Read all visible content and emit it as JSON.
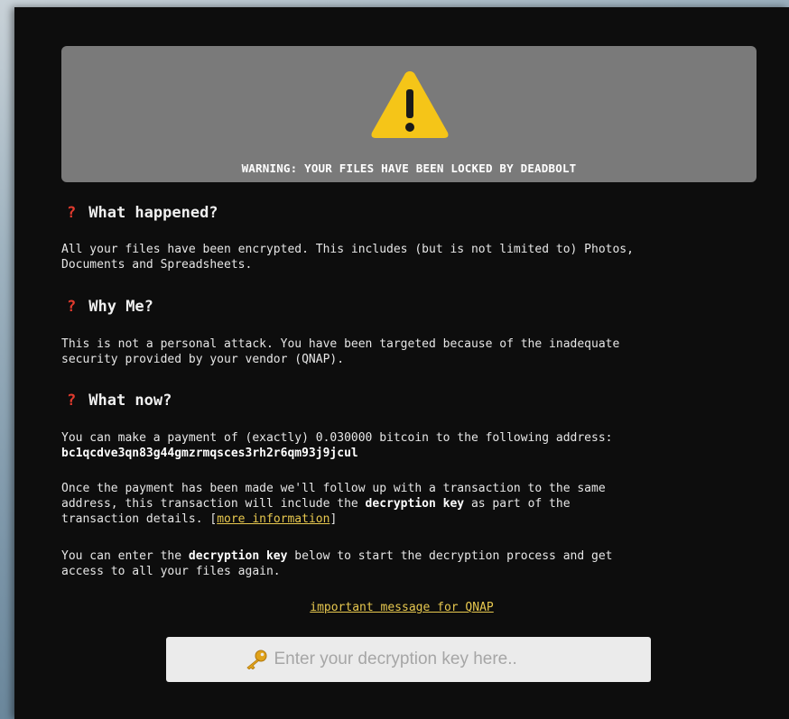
{
  "banner": {
    "icon": "warning-triangle-icon",
    "warning_text": "WARNING: YOUR FILES HAVE BEEN LOCKED BY DEADBOLT"
  },
  "sections": {
    "what_happened": {
      "icon": "question-mark-icon",
      "heading": "What happened?",
      "body": "All your files have been encrypted. This includes (but is not limited to) Photos,\nDocuments and Spreadsheets."
    },
    "why_me": {
      "icon": "question-mark-icon",
      "heading": "Why Me?",
      "body": "This is not a personal attack. You have been targeted because of the inadequate\nsecurity provided by your vendor (QNAP)."
    },
    "what_now": {
      "icon": "question-mark-icon",
      "heading": "What now?",
      "payment_line": "You can make a payment of (exactly) 0.030000 bitcoin to the following address:",
      "btc_address": "bc1qcdve3qn83g44gmzrmqsces3rh2r6qm93j9jcul",
      "followup_part1": "Once the payment has been made we'll follow up with a transaction to the same\naddress, this transaction will include the ",
      "followup_bold": "decryption key",
      "followup_part2": " as part of the\ntransaction details. ",
      "more_info_link": "more information",
      "enter_part1": "You can enter the ",
      "enter_bold": "decryption key",
      "enter_part2": " below to start the decryption process and get\naccess to all your files again."
    }
  },
  "qnap_link": "important message for QNAP",
  "key_input": {
    "icon": "key-icon",
    "placeholder": "Enter your decryption key here.."
  },
  "colors": {
    "background": "#0d0d0d",
    "banner": "#7a7a7a",
    "warning_yellow": "#f5c518",
    "question_red": "#e23b2e",
    "link_yellow": "#e7c84f"
  }
}
